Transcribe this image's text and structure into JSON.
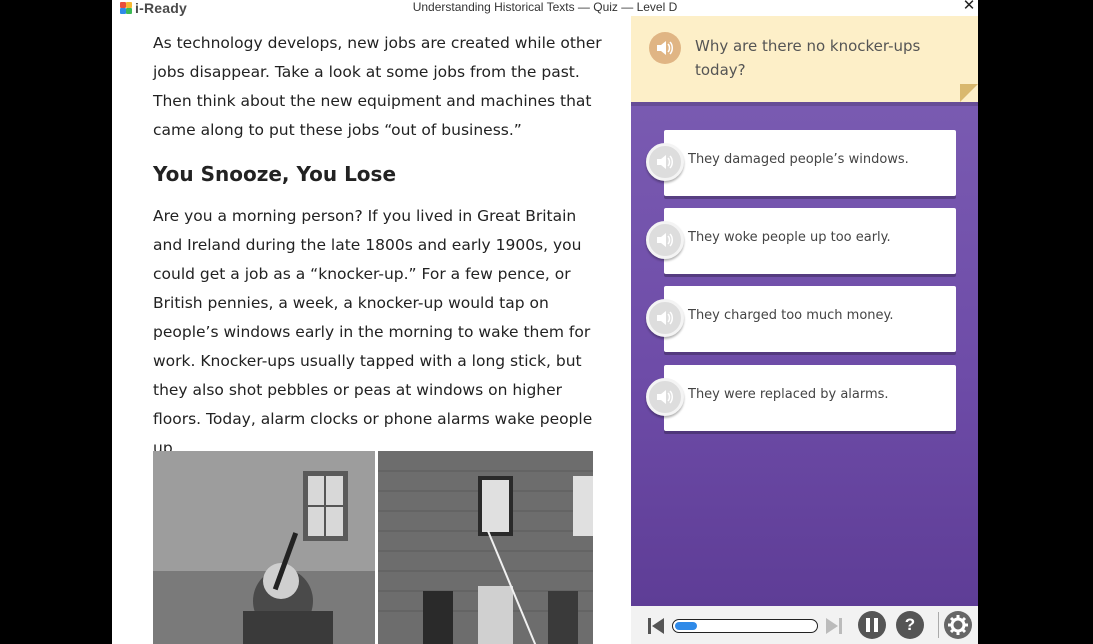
{
  "app": {
    "logo_text": "i-Ready",
    "window_title": "Understanding Historical Texts — Quiz — Level D",
    "close_symbol": "✕"
  },
  "reading": {
    "intro": "As technology develops, new jobs are created while other jobs disappear. Take a look at some jobs from the past. Then think about the new equipment and machines that came along to put these jobs “out of business.”",
    "heading": "You Snooze, You Lose",
    "body": "Are you a morning person? If you lived in Great Britain and Ireland during the late 1800s and early 1900s, you could get a job as a “knocker-up.” For a few pence, or British pennies, a week, a knocker-up would tap on people’s windows early in the morning to wake them for work. Knocker-ups usually tapped with a long stick, but they also shot pebbles or peas at windows on higher floors. Today, alarm clocks or phone alarms wake people up."
  },
  "quiz": {
    "question": "Why are there no knocker-ups today?",
    "answers": [
      {
        "label": "They damaged people’s windows."
      },
      {
        "label": "They woke people up too early."
      },
      {
        "label": "They charged too much money."
      },
      {
        "label": "They were replaced by alarms."
      }
    ]
  },
  "controls": {
    "progress_fraction": 0.16,
    "help_label": "?",
    "icons": [
      "skip-back-icon",
      "skip-forward-icon",
      "pause-icon",
      "help-icon",
      "settings-icon"
    ]
  },
  "colors": {
    "quiz_panel": "#6e4ca8",
    "question_box": "#fdefc8",
    "speaker_orange": "#e0b584",
    "progress": "#2f8ae8"
  }
}
